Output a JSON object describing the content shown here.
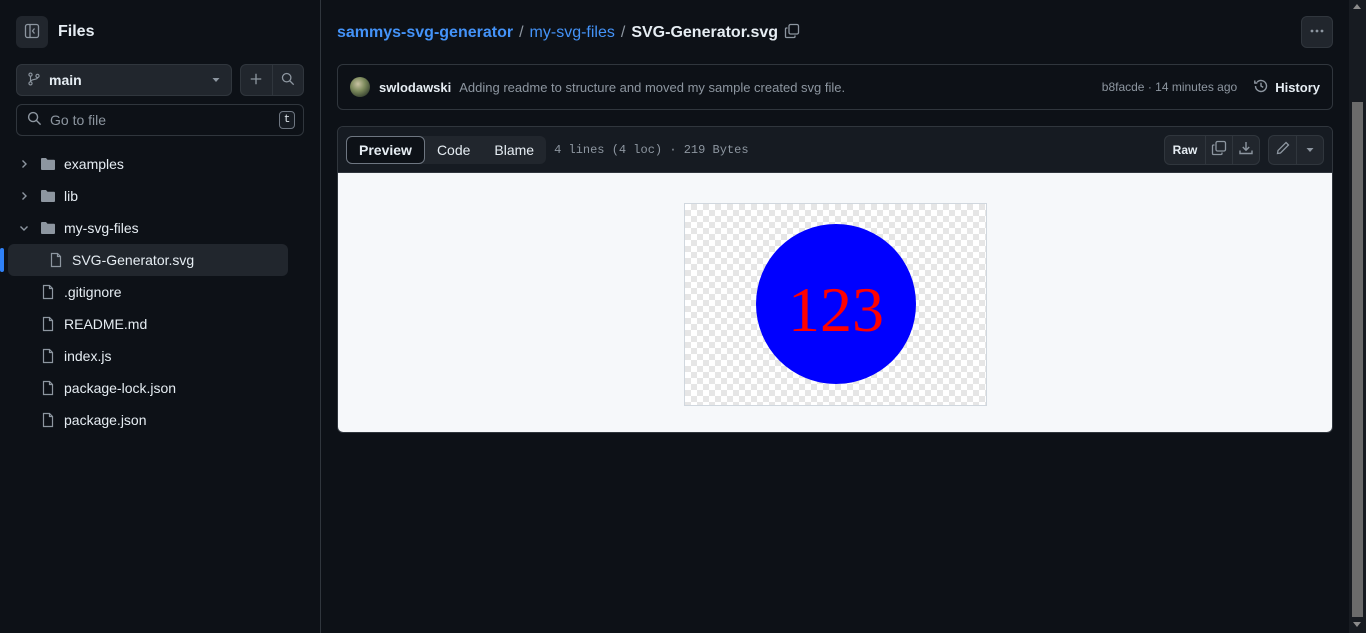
{
  "sidebar": {
    "title": "Files",
    "branch": "main",
    "goto_placeholder": "Go to file",
    "goto_shortcut": "t",
    "tree": [
      {
        "label": "examples",
        "type": "folder",
        "expanded": false,
        "depth": 0
      },
      {
        "label": "lib",
        "type": "folder",
        "expanded": false,
        "depth": 0
      },
      {
        "label": "my-svg-files",
        "type": "folder",
        "expanded": true,
        "depth": 0
      },
      {
        "label": "SVG-Generator.svg",
        "type": "file",
        "depth": 1,
        "active": true
      },
      {
        "label": ".gitignore",
        "type": "file",
        "depth": 0
      },
      {
        "label": "README.md",
        "type": "file",
        "depth": 0
      },
      {
        "label": "index.js",
        "type": "file",
        "depth": 0
      },
      {
        "label": "package-lock.json",
        "type": "file",
        "depth": 0
      },
      {
        "label": "package.json",
        "type": "file",
        "depth": 0
      }
    ]
  },
  "breadcrumb": {
    "repo": "sammys-svg-generator",
    "folder": "my-svg-files",
    "file": "SVG-Generator.svg",
    "separator": "/"
  },
  "commit": {
    "author": "swlodawski",
    "message": "Adding readme to structure and moved my sample created svg file.",
    "sha_time": "b8facde · 14 minutes ago",
    "history_label": "History"
  },
  "file": {
    "tabs": [
      "Preview",
      "Code",
      "Blame"
    ],
    "active_tab": "Preview",
    "meta": "4 lines (4 loc) · 219 Bytes",
    "raw_label": "Raw"
  },
  "svg_preview": {
    "text": "123",
    "circle_fill": "#0000ff",
    "text_fill": "#ff0000"
  },
  "colors": {
    "accent": "#4493f8",
    "background": "#0d1117",
    "border": "#30363d"
  }
}
